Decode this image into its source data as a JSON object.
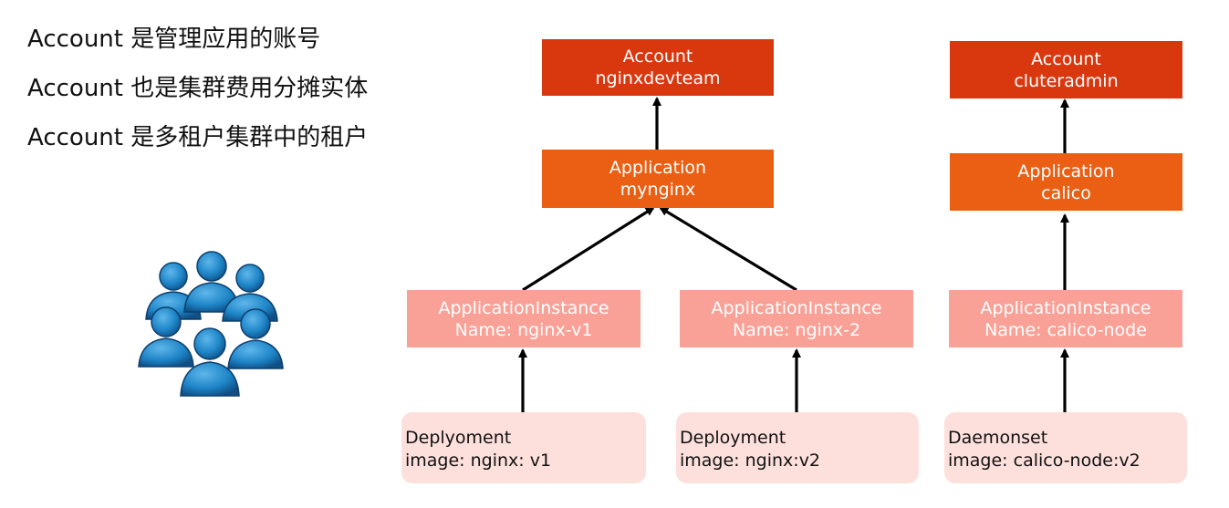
{
  "intro_lines": [
    "Account 是管理应用的账号",
    "Account 也是集群费用分摊实体",
    "Account 是多租户集群中的租户"
  ],
  "icon": "user-group-icon",
  "colors": {
    "account": "#d9380f",
    "application": "#ea5f14",
    "instance": "#f9a197",
    "workload": "#fde0dc",
    "icon_blue": "#1f86c8",
    "arrow": "#000000"
  },
  "trees": [
    {
      "account": {
        "type": "Account",
        "name": "nginxdevteam"
      },
      "application": {
        "type": "Application",
        "name": "mynginx"
      },
      "instances": [
        {
          "type": "ApplicationInstance",
          "name": "Name: nginx-v1",
          "workload": {
            "kind": "Deplyoment",
            "image": "image: nginx: v1"
          }
        },
        {
          "type": "ApplicationInstance",
          "name": "Name: nginx-2",
          "workload": {
            "kind": "Deployment",
            "image": "image: nginx:v2"
          }
        }
      ]
    },
    {
      "account": {
        "type": "Account",
        "name": "cluteradmin"
      },
      "application": {
        "type": "Application",
        "name": "calico"
      },
      "instances": [
        {
          "type": "ApplicationInstance",
          "name": "Name: calico-node",
          "workload": {
            "kind": "Daemonset",
            "image": "image: calico-node:v2"
          }
        }
      ]
    }
  ]
}
